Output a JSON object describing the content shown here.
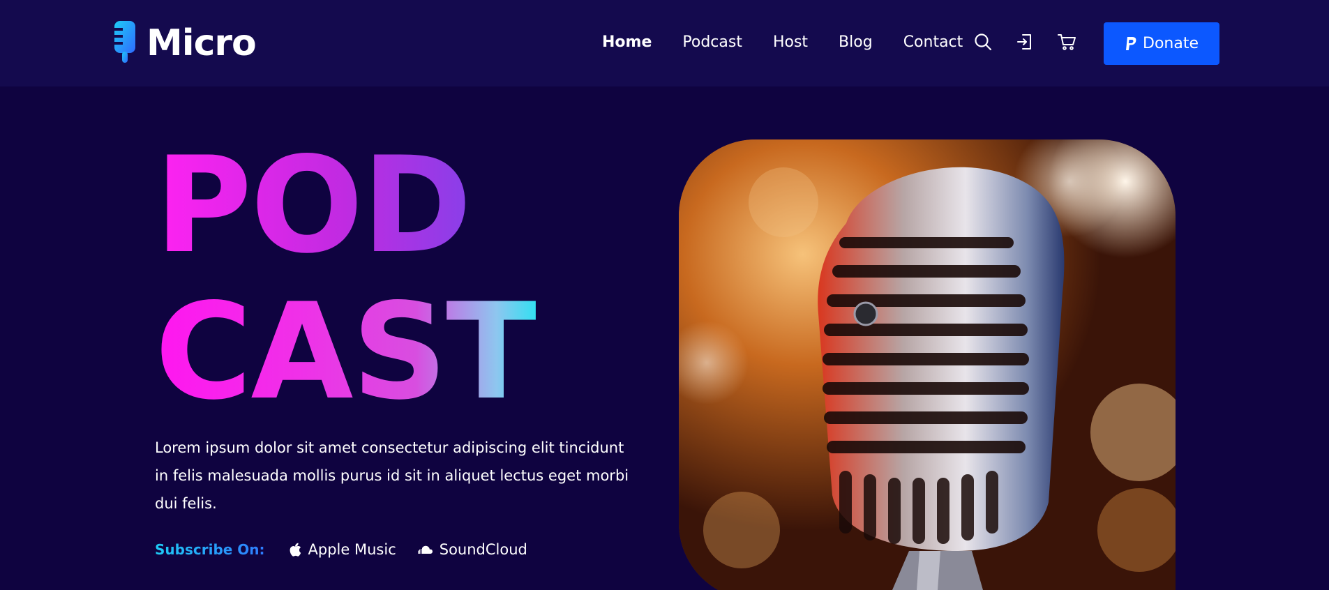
{
  "header": {
    "brand": "Micro",
    "nav": [
      "Home",
      "Podcast",
      "Host",
      "Blog",
      "Contact"
    ],
    "icons": [
      "search-icon",
      "login-icon",
      "cart-icon"
    ],
    "donate_label": "Donate"
  },
  "hero": {
    "title_line1": "POD",
    "title_line2": "CAST",
    "description": "Lorem ipsum dolor sit amet consectetur adipiscing elit tincidunt in felis malesuada mollis purus id sit in aliquet lectus eget morbi dui felis.",
    "subscribe_label": "Subscribe On:",
    "platforms": [
      {
        "label": "Apple Music",
        "icon": "apple-icon"
      },
      {
        "label": "SoundCloud",
        "icon": "soundcloud-icon"
      }
    ]
  },
  "colors": {
    "background": "#0f0340",
    "header_bg": "#140a4e",
    "accent_blue": "#0c58ff",
    "gradient_pink": "#ff1ef4",
    "gradient_cyan": "#00f2ee"
  }
}
